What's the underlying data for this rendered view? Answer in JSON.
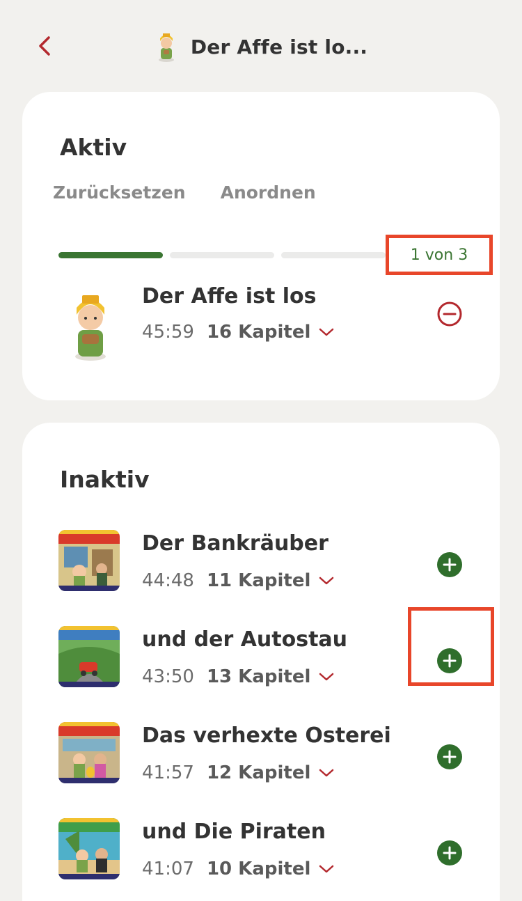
{
  "header": {
    "title": "Der Affe ist lo...",
    "back_icon": "chevron-left-icon",
    "figure_icon": "tonie-figure-icon"
  },
  "active": {
    "section_title": "Aktiv",
    "reset_label": "Zurücksetzen",
    "arrange_label": "Anordnen",
    "progress": {
      "current": 1,
      "total": 3
    },
    "counter_text": "1 von 3",
    "item": {
      "title": "Der Affe ist los",
      "duration": "45:59",
      "chapters": "16 Kapitel",
      "action_icon": "minus-circle-icon"
    }
  },
  "inactive": {
    "section_title": "Inaktiv",
    "items": [
      {
        "title": "Der Bankräuber",
        "duration": "44:48",
        "chapters": "11 Kapitel",
        "action_icon": "plus-circle-icon"
      },
      {
        "title": "und der Autostau",
        "duration": "43:50",
        "chapters": "13 Kapitel",
        "action_icon": "plus-circle-icon"
      },
      {
        "title": "Das verhexte Osterei",
        "duration": "41:57",
        "chapters": "12 Kapitel",
        "action_icon": "plus-circle-icon"
      },
      {
        "title": "und Die Piraten",
        "duration": "41:07",
        "chapters": "10 Kapitel",
        "action_icon": "plus-circle-icon"
      }
    ]
  },
  "colors": {
    "accent_red": "#b3282d",
    "accent_green": "#2f6e2c",
    "highlight": "#e8462a",
    "background": "#f2f1ee"
  }
}
